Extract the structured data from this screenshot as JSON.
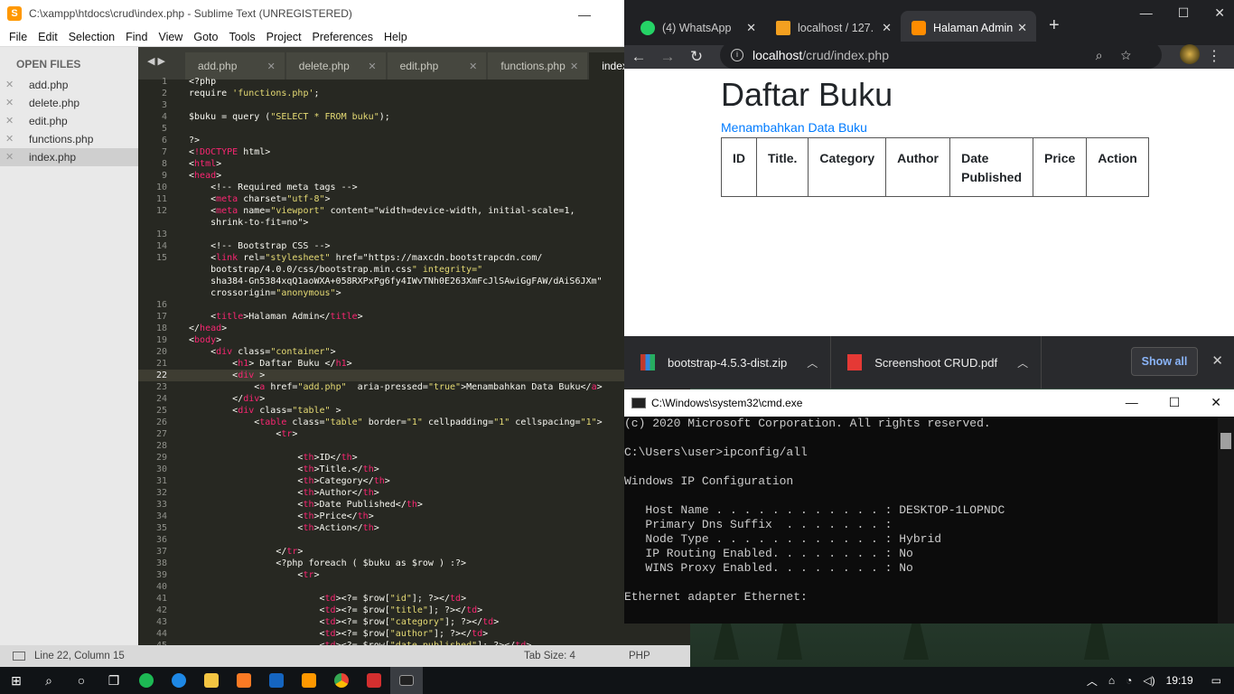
{
  "sublime": {
    "title": "C:\\xampp\\htdocs\\crud\\index.php - Sublime Text (UNREGISTERED)",
    "menu": [
      "File",
      "Edit",
      "Selection",
      "Find",
      "View",
      "Goto",
      "Tools",
      "Project",
      "Preferences",
      "Help"
    ],
    "sidebar_header": "OPEN FILES",
    "files": [
      "add.php",
      "delete.php",
      "edit.php",
      "functions.php",
      "index.php"
    ],
    "tabs": [
      "add.php",
      "delete.php",
      "edit.php",
      "functions.php",
      "index.php"
    ],
    "status_position": "Line 22, Column 15",
    "status_tabsize": "Tab Size: 4",
    "status_syntax": "PHP",
    "code_lines": [
      {
        "n": "1",
        "t": "<?php"
      },
      {
        "n": "2",
        "t": "require 'functions.php';"
      },
      {
        "n": "3",
        "t": ""
      },
      {
        "n": "4",
        "t": "$buku = query (\"SELECT * FROM buku\");"
      },
      {
        "n": "5",
        "t": ""
      },
      {
        "n": "6",
        "t": "?>"
      },
      {
        "n": "7",
        "t": "<!DOCTYPE html>"
      },
      {
        "n": "8",
        "t": "<html>"
      },
      {
        "n": "9",
        "t": "<head>"
      },
      {
        "n": "10",
        "t": "    <!-- Required meta tags -->"
      },
      {
        "n": "11",
        "t": "    <meta charset=\"utf-8\">"
      },
      {
        "n": "12",
        "t": "    <meta name=\"viewport\" content=\"width=device-width, initial-scale=1,"
      },
      {
        "n": "",
        "t": "    shrink-to-fit=no\">"
      },
      {
        "n": "13",
        "t": ""
      },
      {
        "n": "14",
        "t": "    <!-- Bootstrap CSS -->"
      },
      {
        "n": "15",
        "t": "    <link rel=\"stylesheet\" href=\"https://maxcdn.bootstrapcdn.com/"
      },
      {
        "n": "",
        "t": "    bootstrap/4.0.0/css/bootstrap.min.css\" integrity=\""
      },
      {
        "n": "",
        "t": "    sha384-Gn5384xqQ1aoWXA+058RXPxPg6fy4IWvTNh0E263XmFcJlSAwiGgFAW/dAiS6JXm\""
      },
      {
        "n": "",
        "t": "    crossorigin=\"anonymous\">"
      },
      {
        "n": "16",
        "t": ""
      },
      {
        "n": "17",
        "t": "    <title>Halaman Admin</title>"
      },
      {
        "n": "18",
        "t": "</head>"
      },
      {
        "n": "19",
        "t": "<body>"
      },
      {
        "n": "20",
        "t": "    <div class=\"container\">"
      },
      {
        "n": "21",
        "t": "        <h1> Daftar Buku </h1>"
      },
      {
        "n": "22",
        "t": "        <div >"
      },
      {
        "n": "23",
        "t": "            <a href=\"add.php\"  aria-pressed=\"true\">Menambahkan Data Buku</a>"
      },
      {
        "n": "24",
        "t": "        </div>"
      },
      {
        "n": "25",
        "t": "        <div class=\"table\" >"
      },
      {
        "n": "26",
        "t": "            <table class=\"table\" border=\"1\" cellpadding=\"1\" cellspacing=\"1\">"
      },
      {
        "n": "27",
        "t": "                <tr>"
      },
      {
        "n": "28",
        "t": ""
      },
      {
        "n": "29",
        "t": "                    <th>ID</th>"
      },
      {
        "n": "30",
        "t": "                    <th>Title.</th>"
      },
      {
        "n": "31",
        "t": "                    <th>Category</th>"
      },
      {
        "n": "32",
        "t": "                    <th>Author</th>"
      },
      {
        "n": "33",
        "t": "                    <th>Date Published</th>"
      },
      {
        "n": "34",
        "t": "                    <th>Price</th>"
      },
      {
        "n": "35",
        "t": "                    <th>Action</th>"
      },
      {
        "n": "36",
        "t": ""
      },
      {
        "n": "37",
        "t": "                </tr>"
      },
      {
        "n": "38",
        "t": "                <?php foreach ( $buku as $row ) :?>"
      },
      {
        "n": "39",
        "t": "                    <tr>"
      },
      {
        "n": "40",
        "t": ""
      },
      {
        "n": "41",
        "t": "                        <td><?= $row[\"id\"]; ?></td>"
      },
      {
        "n": "42",
        "t": "                        <td><?= $row[\"title\"]; ?></td>"
      },
      {
        "n": "43",
        "t": "                        <td><?= $row[\"category\"]; ?></td>"
      },
      {
        "n": "44",
        "t": "                        <td><?= $row[\"author\"]; ?></td>"
      },
      {
        "n": "45",
        "t": "                        <td><?= $row[\"date_published\"]; ?></td>"
      }
    ]
  },
  "chrome": {
    "tabs": [
      {
        "label": "(4) WhatsApp",
        "color": "#25d366"
      },
      {
        "label": "localhost / 127.",
        "color": "#f4a020"
      },
      {
        "label": "Halaman Admin",
        "color": "#ff8c00"
      }
    ],
    "url_host": "localhost",
    "url_path": "/crud/index.php",
    "page_title": "Daftar Buku",
    "page_link": "Menambahkan Data Buku",
    "table_headers": [
      "ID",
      "Title.",
      "Category",
      "Author",
      "Date Published",
      "Price",
      "Action"
    ],
    "downloads": [
      {
        "name": "bootstrap-4.5.3-dist.zip",
        "icon": "zip-icon"
      },
      {
        "name": "Screenshoot CRUD.pdf",
        "icon": "pdf-icon"
      }
    ],
    "show_all": "Show all"
  },
  "cmd": {
    "title": "C:\\Windows\\system32\\cmd.exe",
    "lines": [
      "(c) 2020 Microsoft Corporation. All rights reserved.",
      "",
      "C:\\Users\\user>ipconfig/all",
      "",
      "Windows IP Configuration",
      "",
      "   Host Name . . . . . . . . . . . . : DESKTOP-1LOPNDC",
      "   Primary Dns Suffix  . . . . . . . :",
      "   Node Type . . . . . . . . . . . . : Hybrid",
      "   IP Routing Enabled. . . . . . . . : No",
      "   WINS Proxy Enabled. . . . . . . . : No",
      "",
      "Ethernet adapter Ethernet:"
    ]
  },
  "taskbar": {
    "time": "19:19"
  }
}
